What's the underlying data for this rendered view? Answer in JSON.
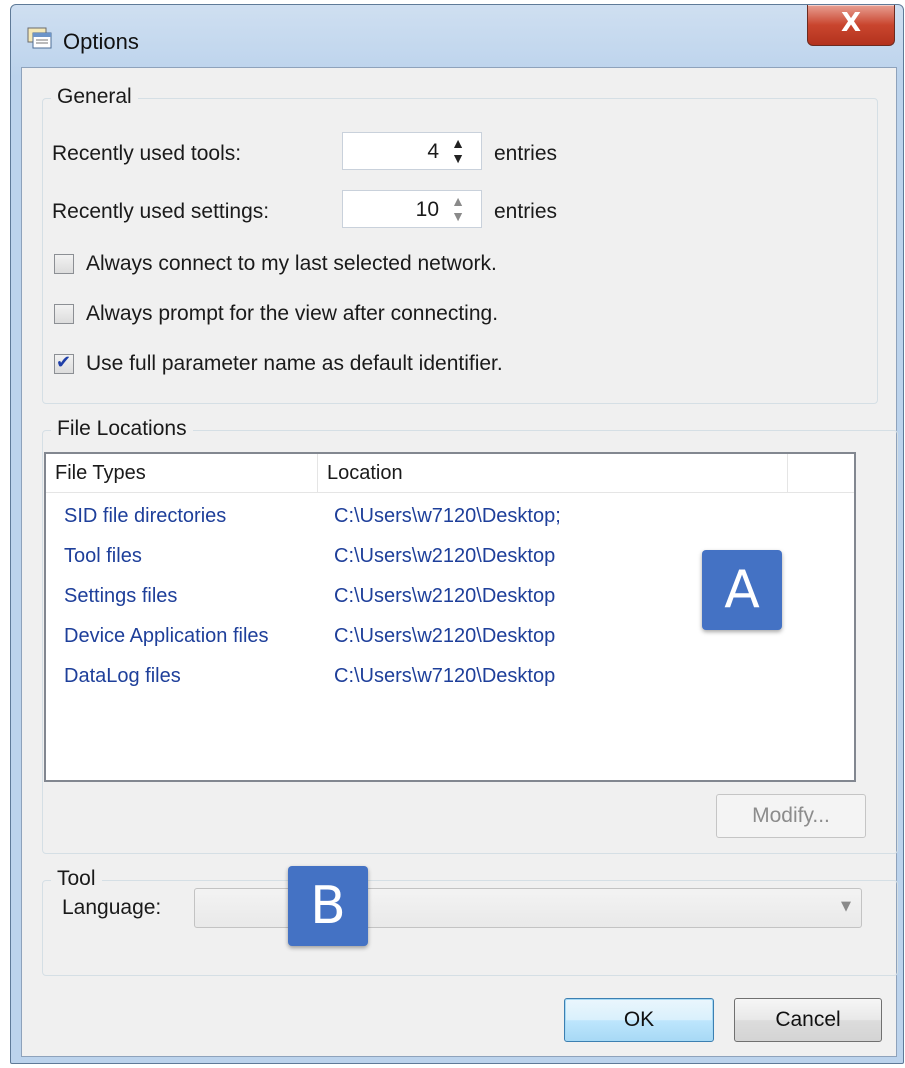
{
  "window": {
    "title": "Options",
    "close_label": "X"
  },
  "general": {
    "legend": "General",
    "recent_tools_label": "Recently used tools:",
    "recent_tools_value": "4",
    "recent_settings_label": "Recently used settings:",
    "recent_settings_value": "10",
    "entries_label": "entries",
    "checkboxes": [
      {
        "label": "Always connect to my last selected network.",
        "checked": false
      },
      {
        "label": "Always prompt for the view after connecting.",
        "checked": false
      },
      {
        "label": "Use full parameter name as default identifier.",
        "checked": true
      }
    ]
  },
  "file_locations": {
    "legend": "File Locations",
    "columns": [
      "File Types",
      "Location"
    ],
    "rows": [
      {
        "type": "SID file directories",
        "location": "C:\\Users\\w7120\\Desktop;"
      },
      {
        "type": "Tool files",
        "location": "C:\\Users\\w2120\\Desktop"
      },
      {
        "type": "Settings files",
        "location": "C:\\Users\\w2120\\Desktop"
      },
      {
        "type": "Device Application files",
        "location": "C:\\Users\\w2120\\Desktop"
      },
      {
        "type": "DataLog files",
        "location": "C:\\Users\\w7120\\Desktop"
      }
    ],
    "modify_label": "Modify..."
  },
  "tool": {
    "legend": "Tool",
    "language_label": "Language:",
    "language_value": ""
  },
  "buttons": {
    "ok": "OK",
    "cancel": "Cancel"
  },
  "annotations": {
    "a": "A",
    "b": "B",
    "color": "#4472c4"
  },
  "icons": {
    "title": "options-window-icon",
    "spin_up": "chevron-up-icon",
    "spin_down": "chevron-down-icon",
    "combo_arrow": "dropdown-arrow-icon",
    "check": "checkmark-icon"
  }
}
